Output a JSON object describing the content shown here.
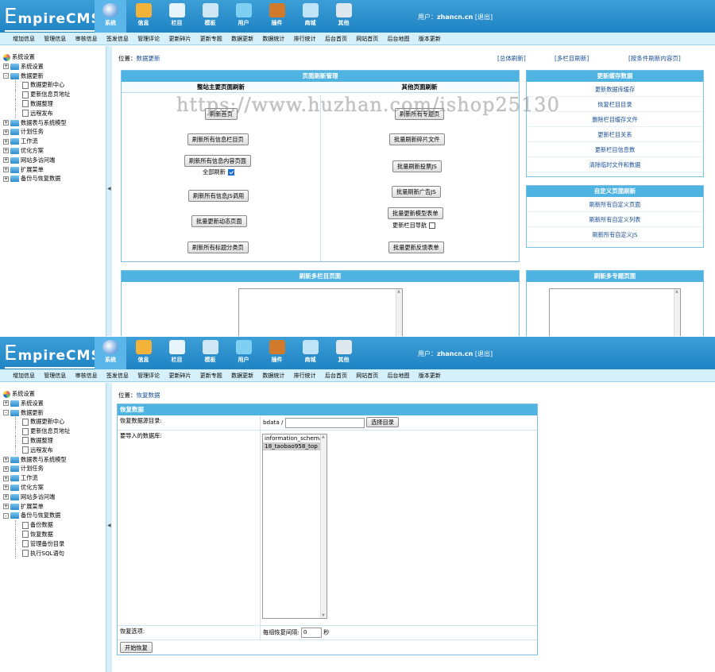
{
  "header": {
    "logo_big": "E",
    "logo_rest": "mpireCMS",
    "nav": [
      {
        "label": "系统",
        "icon": "globe-icon",
        "color": "#ffffff"
      },
      {
        "label": "信息",
        "icon": "edit-icon",
        "color": "#f3b23a"
      },
      {
        "label": "栏目",
        "icon": "folder-icon",
        "color": "#e8f4fb"
      },
      {
        "label": "模板",
        "icon": "template-icon",
        "color": "#cfe6f5"
      },
      {
        "label": "用户",
        "icon": "user-icon",
        "color": "#7ed0f2"
      },
      {
        "label": "插件",
        "icon": "plugin-icon",
        "color": "#d27a2c"
      },
      {
        "label": "商城",
        "icon": "shop-icon",
        "color": "#bfe3f7"
      },
      {
        "label": "其他",
        "icon": "gear-icon",
        "color": "#dfe8ee"
      }
    ],
    "user_label": "用户：",
    "user_name": "zhancn.cn",
    "logout": "[退出]"
  },
  "menubar": [
    "增加信息",
    "管理信息",
    "审核信息",
    "签发信息",
    "管理评论",
    "更新碎片",
    "更新专题",
    "数据更新",
    "数据统计",
    "排行统计",
    "后台首页",
    "网站首页",
    "后台地图",
    "版本更新"
  ],
  "tree1": [
    {
      "type": "root",
      "label": "系统设置"
    },
    {
      "type": "folder",
      "fold": "+",
      "label": "系统设置"
    },
    {
      "type": "folder",
      "fold": "-",
      "label": "数据更新"
    },
    {
      "type": "sub",
      "label": "数据更新中心"
    },
    {
      "type": "sub",
      "label": "更新信息页地址"
    },
    {
      "type": "sub",
      "label": "数据整理"
    },
    {
      "type": "sub",
      "label": "远程发布"
    },
    {
      "type": "folder",
      "fold": "+",
      "label": "数据表与系统模型"
    },
    {
      "type": "folder",
      "fold": "+",
      "label": "计划任务"
    },
    {
      "type": "folder",
      "fold": "+",
      "label": "工作流"
    },
    {
      "type": "folder",
      "fold": "+",
      "label": "优化方案"
    },
    {
      "type": "folder",
      "fold": "+",
      "label": "网站多访问端"
    },
    {
      "type": "folder",
      "fold": "+",
      "label": "扩展菜单"
    },
    {
      "type": "folder",
      "fold": "+",
      "label": "备份与恢复数据"
    }
  ],
  "tree2": [
    {
      "type": "root",
      "label": "系统设置"
    },
    {
      "type": "folder",
      "fold": "+",
      "label": "系统设置"
    },
    {
      "type": "folder",
      "fold": "-",
      "label": "数据更新"
    },
    {
      "type": "sub",
      "label": "数据更新中心"
    },
    {
      "type": "sub",
      "label": "更新信息页地址"
    },
    {
      "type": "sub",
      "label": "数据整理"
    },
    {
      "type": "sub",
      "label": "远程发布"
    },
    {
      "type": "folder",
      "fold": "+",
      "label": "数据表与系统模型"
    },
    {
      "type": "folder",
      "fold": "+",
      "label": "计划任务"
    },
    {
      "type": "folder",
      "fold": "+",
      "label": "工作流"
    },
    {
      "type": "folder",
      "fold": "+",
      "label": "优化方案"
    },
    {
      "type": "folder",
      "fold": "+",
      "label": "网站多访问端"
    },
    {
      "type": "folder",
      "fold": "+",
      "label": "扩展菜单"
    },
    {
      "type": "folder",
      "fold": "-",
      "label": "备份与恢复数据"
    },
    {
      "type": "sub",
      "label": "备份数据"
    },
    {
      "type": "sub",
      "label": "恢复数据"
    },
    {
      "type": "sub",
      "label": "管理备份目录"
    },
    {
      "type": "sub",
      "label": "执行SQL语句"
    }
  ],
  "page1": {
    "pos_label": "位置：",
    "pos_link": "数据更新",
    "top_links": [
      "[总体刷新]",
      "[多栏目刷新]",
      "[按条件刷新内容页]"
    ],
    "main_panel": {
      "title": "页面刷新管理",
      "left_head": "整站主要页面刷新",
      "right_head": "其他页面刷新",
      "left_buttons": [
        "刷新首页",
        "刷新所有信息栏目页",
        "刷新所有信息内容页面",
        "刷新所有信息JS调用",
        "批量更新动态页面",
        "刷新所有标题分类页"
      ],
      "full_refresh_label": "全部刷新",
      "right_buttons": [
        "刷新所有专题页",
        "批量刷新碎片文件",
        "批量刷新投票JS",
        "批量刷新广告JS",
        "批量更新模型表单",
        "批量更新反馈表单"
      ],
      "nav_update_label": "更新栏目导航"
    },
    "cache_panel": {
      "title": "更新缓存数据",
      "items": [
        "更新数据库缓存",
        "恢复栏目目录",
        "删除栏目缓存文件",
        "更新栏目关系",
        "更新栏目信息数",
        "清除临时文件和数据"
      ]
    },
    "custom_panel": {
      "title": "自定义页面刷新",
      "items": [
        "刷新所有自定义页面",
        "刷新所有自定义列表",
        "刷新所有自定义JS"
      ]
    },
    "multi_col_title": "刷新多栏目页面",
    "multi_topic_title": "刷新多专题页面"
  },
  "page2": {
    "pos_label": "位置：",
    "pos_link": "恢复数据",
    "form_title": "恢复数据",
    "dir_label": "恢复数据源目录:",
    "dir_prefix": "bdata /",
    "dir_value": "",
    "choose_dir": "选择目录",
    "db_label": "要导入的数据库:",
    "db_options": [
      "information_schema",
      "18_taobao958_top"
    ],
    "db_selected": 1,
    "opt_label": "恢复选项:",
    "interval_label": "每组恢复间隔:",
    "interval_value": "0",
    "interval_unit": "秒",
    "start_button": "开始恢复"
  },
  "watermark": "https://www.huzhan.com/ishop25130",
  "colors": {
    "header": "#2a8fcf",
    "panel_head": "#4fb3e2",
    "menubar": "#d6f0fb",
    "link": "#1a4f96"
  }
}
